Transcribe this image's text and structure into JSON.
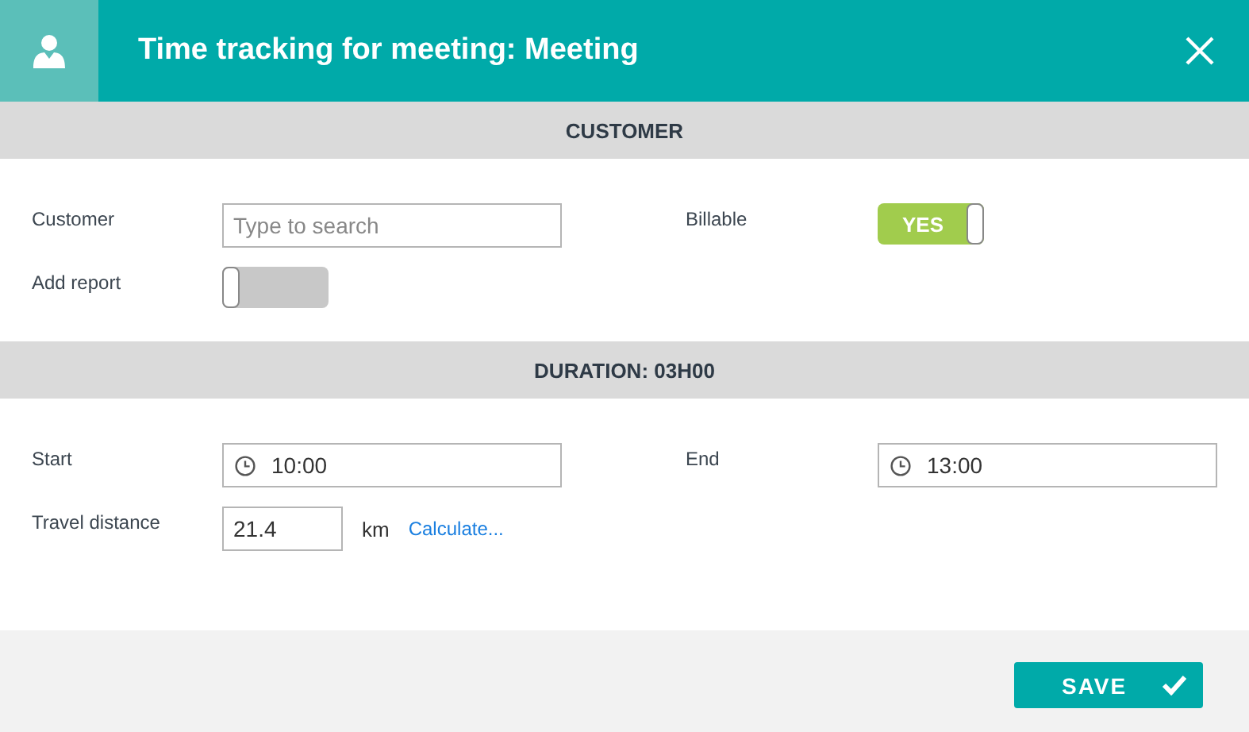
{
  "window": {
    "title": "Time tracking for meeting: Meeting"
  },
  "sections": [
    {
      "title": "CUSTOMER",
      "rows": [
        {
          "kind": "search",
          "label": "Customer",
          "placeholder": "Type to search",
          "right": {
            "kind": "toggle",
            "label": "Billable",
            "on": true,
            "on_label": "YES"
          }
        },
        {
          "kind": "toggle",
          "label": "Add report",
          "on": false
        }
      ]
    },
    {
      "title": "DURATION: 03H00",
      "rows": [
        {
          "kind": "time",
          "label": "Start",
          "value": "10:00",
          "right": {
            "kind": "time",
            "label": "End",
            "value": "13:00"
          }
        },
        {
          "kind": "distance",
          "label": "Travel distance",
          "value": "21.4",
          "unit": "km",
          "link": "Calculate..."
        }
      ]
    }
  ],
  "footer": {
    "save": "SAVE"
  }
}
